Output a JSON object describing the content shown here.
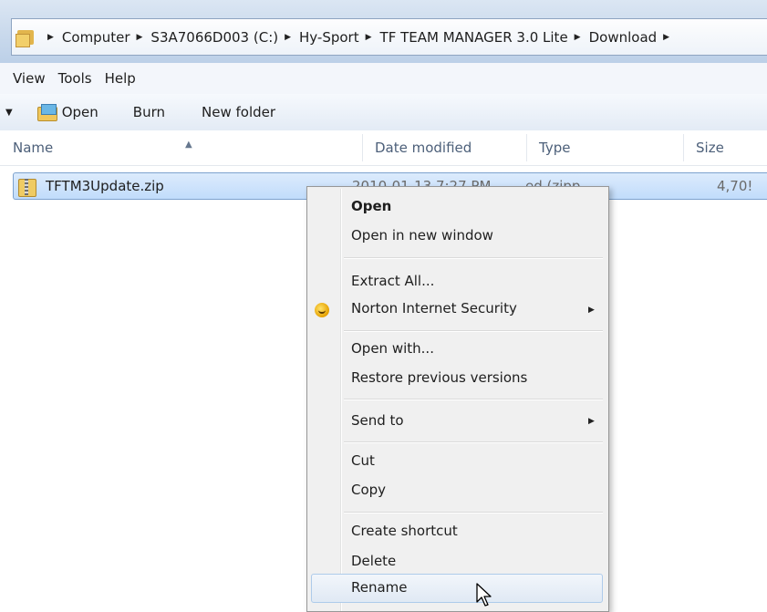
{
  "breadcrumb": [
    "Computer",
    "S3A7066D003 (C:)",
    "Hy-Sport",
    "TF TEAM MANAGER 3.0 Lite",
    "Download"
  ],
  "menu": [
    "View",
    "Tools",
    "Help"
  ],
  "toolbar": {
    "open": "Open",
    "burn": "Burn",
    "new_folder": "New folder"
  },
  "columns": {
    "name": "Name",
    "date": "Date modified",
    "type": "Type",
    "size": "Size"
  },
  "file": {
    "name": "TFTM3Update.zip",
    "date": "2010-01-13 7:27 PM",
    "type": "ed (zipp...",
    "size": "4,70!"
  },
  "context_menu": {
    "open": "Open",
    "open_new_window": "Open in new window",
    "extract_all": "Extract All...",
    "norton": "Norton Internet Security",
    "open_with": "Open with...",
    "restore": "Restore previous versions",
    "send_to": "Send to",
    "cut": "Cut",
    "copy": "Copy",
    "create_shortcut": "Create shortcut",
    "delete": "Delete",
    "rename": "Rename"
  }
}
